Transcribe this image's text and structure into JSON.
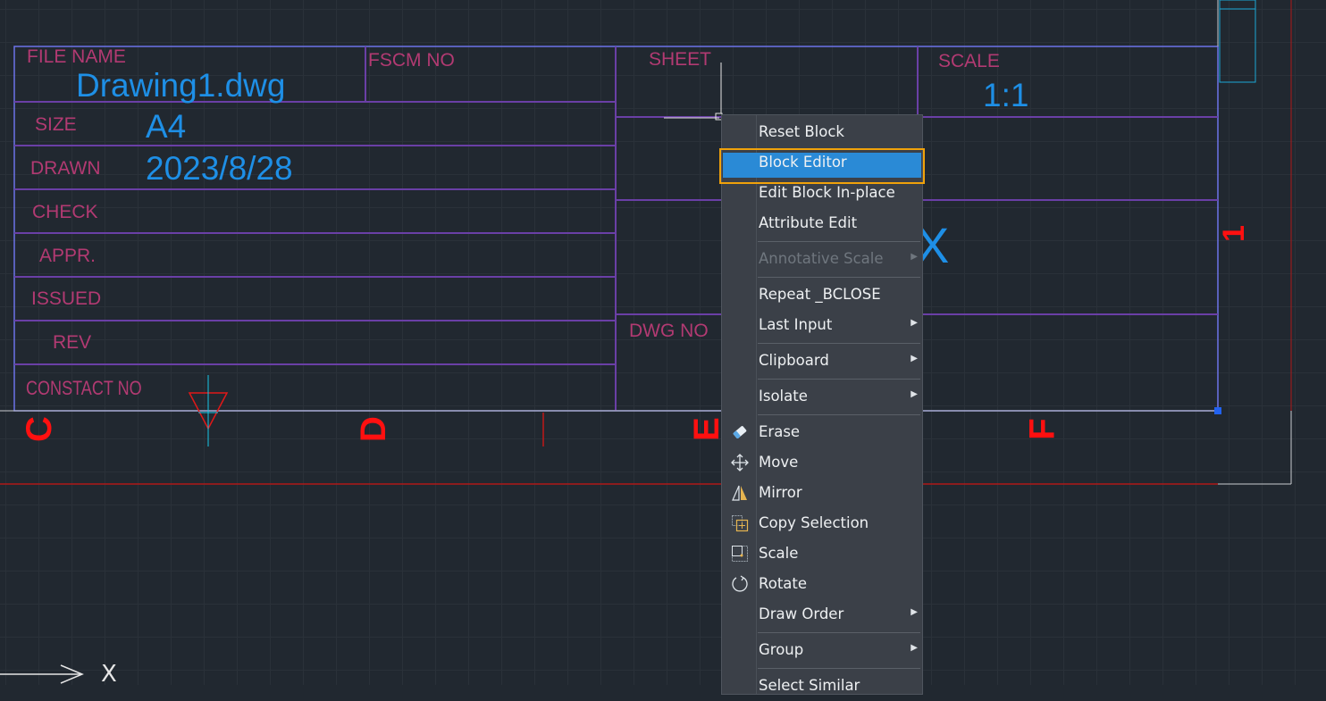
{
  "title_block": {
    "labels": {
      "file_name": "FILE NAME",
      "fscm_no": "FSCM NO",
      "sheet": "SHEET",
      "scale": "SCALE",
      "size": "SIZE",
      "drawn": "DRAWN",
      "check": "CHECK",
      "appr": "APPR.",
      "issued": "ISSUED",
      "rev": "REV",
      "constact_no": "CONSTACT NO",
      "dwg_no": "DWG NO"
    },
    "values": {
      "file_name": "Drawing1.dwg",
      "size": "A4",
      "drawn": "2023/8/28",
      "scale": "1:1",
      "partial_x": "X"
    }
  },
  "zone_markers": [
    "C",
    "D",
    "E",
    "F",
    "1"
  ],
  "ucs_icon_label": "X",
  "context_menu": {
    "items": [
      {
        "label": "Reset Block",
        "icon": "",
        "submenu": false,
        "disabled": false
      },
      {
        "label": "Block Editor",
        "icon": "",
        "submenu": false,
        "disabled": false,
        "highlighted": true
      },
      {
        "label": "Edit Block In-place",
        "icon": "",
        "submenu": false,
        "disabled": false
      },
      {
        "label": "Attribute Edit",
        "icon": "",
        "submenu": false,
        "disabled": false
      },
      {
        "label": "Annotative Scale",
        "icon": "",
        "submenu": true,
        "disabled": true
      },
      {
        "label": "Repeat _BCLOSE",
        "icon": "",
        "submenu": false,
        "disabled": false
      },
      {
        "label": "Last Input",
        "icon": "",
        "submenu": true,
        "disabled": false
      },
      {
        "label": "Clipboard",
        "icon": "",
        "submenu": true,
        "disabled": false
      },
      {
        "label": "Isolate",
        "icon": "",
        "submenu": true,
        "disabled": false
      },
      {
        "label": "Erase",
        "icon": "eraser-icon",
        "submenu": false,
        "disabled": false
      },
      {
        "label": "Move",
        "icon": "move-icon",
        "submenu": false,
        "disabled": false
      },
      {
        "label": "Mirror",
        "icon": "mirror-icon",
        "submenu": false,
        "disabled": false
      },
      {
        "label": "Copy Selection",
        "icon": "copy-icon",
        "submenu": false,
        "disabled": false
      },
      {
        "label": "Scale",
        "icon": "scale-icon",
        "submenu": false,
        "disabled": false
      },
      {
        "label": "Rotate",
        "icon": "rotate-icon",
        "submenu": false,
        "disabled": false
      },
      {
        "label": "Draw Order",
        "icon": "",
        "submenu": true,
        "disabled": false
      },
      {
        "label": "Group",
        "icon": "",
        "submenu": true,
        "disabled": false
      },
      {
        "label": "Select Similar",
        "icon": "",
        "submenu": false,
        "disabled": false
      }
    ]
  },
  "colors": {
    "background": "#212830",
    "table_line": "#7a4fb8",
    "label_text": "#b23a72",
    "value_text": "#1e8fe6",
    "marker_red": "#ff1010",
    "highlight_fill": "#2a8ad6",
    "highlight_border": "#f0a20a"
  }
}
